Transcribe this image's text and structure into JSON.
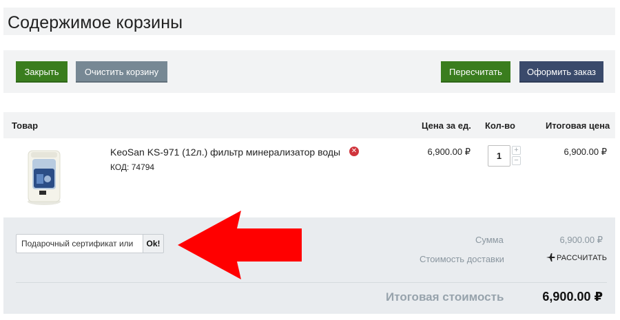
{
  "page": {
    "title": "Содержимое корзины"
  },
  "toolbar": {
    "close_label": "Закрыть",
    "clear_label": "Очистить корзину",
    "recalc_label": "Пересчитать",
    "checkout_label": "Оформить заказ"
  },
  "table": {
    "headers": {
      "product": "Товар",
      "unit_price": "Цена за ед.",
      "quantity": "Кол-во",
      "total_price": "Итоговая цена"
    },
    "items": [
      {
        "name": "KeoSan KS-971 (12л.) фильтр минерализатор воды",
        "code": "КОД: 74794",
        "unit_price": "6,900.00 ₽",
        "quantity": "1",
        "total_price": "6,900.00 ₽"
      }
    ]
  },
  "summary": {
    "coupon_value": "Подарочный сертификат или",
    "coupon_button": "Ok!",
    "sum_label": "Сумма",
    "sum_value": "6,900.00 ₽",
    "delivery_label": "Стоимость доставки",
    "delivery_action": "РАССЧИТАТЬ",
    "total_label": "Итоговая стоимость",
    "total_value": "6,900.00 ₽"
  },
  "colors": {
    "green_button": "#3a7d1e",
    "gray_button": "#778894",
    "navy_button": "#3a4a6b",
    "remove_icon": "#d0343c",
    "annotation_arrow": "#ff0000"
  },
  "icons": [
    "remove-icon",
    "plus-icon",
    "minus-icon",
    "plane-icon",
    "product-image",
    "red-arrow-annotation"
  ]
}
